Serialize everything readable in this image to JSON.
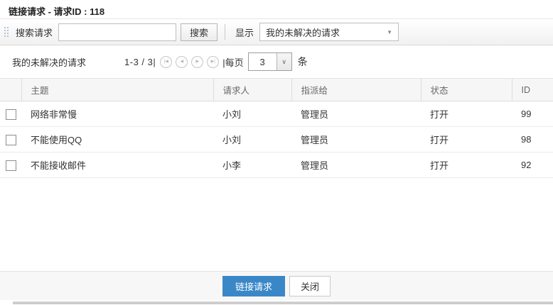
{
  "title": "链接请求 - 请求ID : 118",
  "toolbar": {
    "grip_icon": "drag-grip-dots",
    "search_label": "搜索请求",
    "search_value": "",
    "search_placeholder": "",
    "search_button": "搜索",
    "show_label": "显示",
    "filter_selected": "我的未解决的请求",
    "filter_caret_icon": "▼"
  },
  "pagination": {
    "view_label": "我的未解决的请求",
    "range": "1-3 / 3|",
    "first_icon": "|◀",
    "prev_icon": "◀",
    "next_icon": "▶",
    "last_icon": "▶|",
    "per_page_label": "|每页",
    "page_size": "3",
    "size_caret_icon": "∨",
    "unit_label": "条"
  },
  "table": {
    "headers": [
      "主题",
      "请求人",
      "指派给",
      "状态",
      "ID"
    ],
    "rows": [
      {
        "subject": "网络非常慢",
        "requester": "小刘",
        "assignee": "管理员",
        "status": "打开",
        "id": "99"
      },
      {
        "subject": "不能使用QQ",
        "requester": "小刘",
        "assignee": "管理员",
        "status": "打开",
        "id": "98"
      },
      {
        "subject": "不能接收邮件",
        "requester": "小李",
        "assignee": "管理员",
        "status": "打开",
        "id": "92"
      }
    ]
  },
  "footer": {
    "link_button": "链接请求",
    "close_button": "关闭"
  },
  "colors": {
    "accent_blue": "#3a87c8",
    "header_bg": "#f6f6f6",
    "footer_bg": "#f7f7f7"
  }
}
